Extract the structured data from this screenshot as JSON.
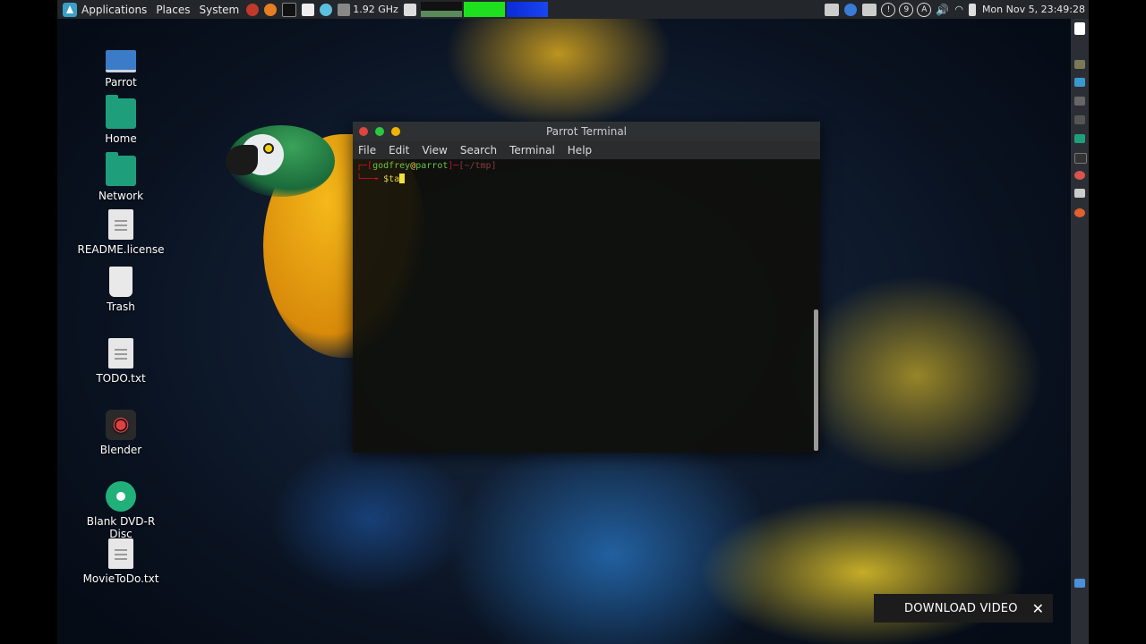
{
  "top_panel": {
    "menus": [
      "Applications",
      "Places",
      "System"
    ],
    "cpu_freq": "1.92 GHz",
    "clock": "Mon Nov  5, 23:49:28",
    "indicators": [
      "!",
      "9",
      "A"
    ]
  },
  "desktop_icons": [
    {
      "label": "Parrot",
      "icon": "laptop-icon"
    },
    {
      "label": "Home",
      "icon": "home-folder-icon"
    },
    {
      "label": "Network",
      "icon": "network-folder-icon"
    },
    {
      "label": "README.license",
      "icon": "text-file-icon"
    },
    {
      "label": "Trash",
      "icon": "trash-icon"
    },
    {
      "label": "TODO.txt",
      "icon": "text-file-icon"
    },
    {
      "label": "Blender",
      "icon": "blender-icon"
    },
    {
      "label": "Blank DVD-R Disc",
      "icon": "disc-icon"
    },
    {
      "label": "MovieToDo.txt",
      "icon": "text-file-icon"
    }
  ],
  "terminal": {
    "title": "Parrot Terminal",
    "menus": [
      "File",
      "Edit",
      "View",
      "Search",
      "Terminal",
      "Help"
    ],
    "prompt_user": "godfrey",
    "prompt_at": "@",
    "prompt_host": "parrot",
    "prompt_path": "[~/tmp]",
    "prompt_symbol": "$",
    "command": "ta"
  },
  "overlay": {
    "download_label": "DOWNLOAD VIDEO",
    "close_glyph": "✕"
  },
  "colors": {
    "panel_bg": "#23262b",
    "terminal_green": "#6ac24a",
    "terminal_red": "#c8102e",
    "cursor_yellow": "#f4e23a"
  }
}
